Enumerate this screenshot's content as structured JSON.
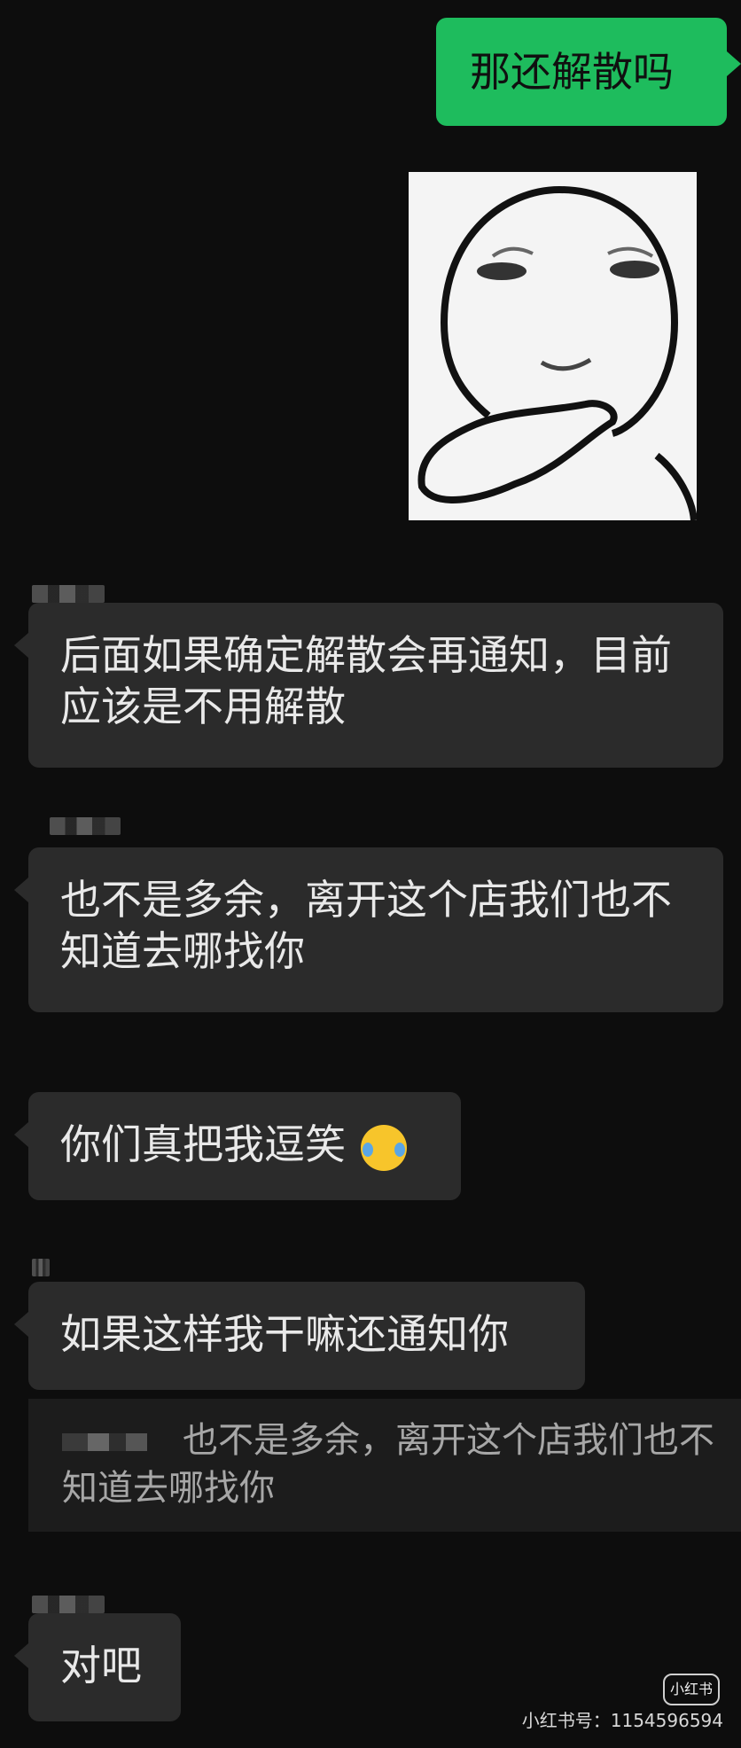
{
  "messages": {
    "out1": "那还解散吗",
    "m1": "后面如果确定解散会再通知，目前应该是不用解散",
    "m2": "也不是多余，离开这个店我们也不知道去哪找你",
    "m3": "你们真把我逗笑",
    "m4": "如果这样我干嘛还通知你",
    "m5": "对吧"
  },
  "quote": {
    "text": "也不是多余，离开这个店我们也不知道去哪找你"
  },
  "sticker": {
    "icon": "thinking-face-sticker-icon"
  },
  "emoji": {
    "icon": "laugh-cry-emoji-icon"
  },
  "watermark": {
    "logo_text": "小红书",
    "id_text": "小红书号：1154596594"
  },
  "colors": {
    "background": "#0d0d0d",
    "incoming_bubble": "#2b2b2b",
    "outgoing_bubble": "#1ebc5d"
  }
}
